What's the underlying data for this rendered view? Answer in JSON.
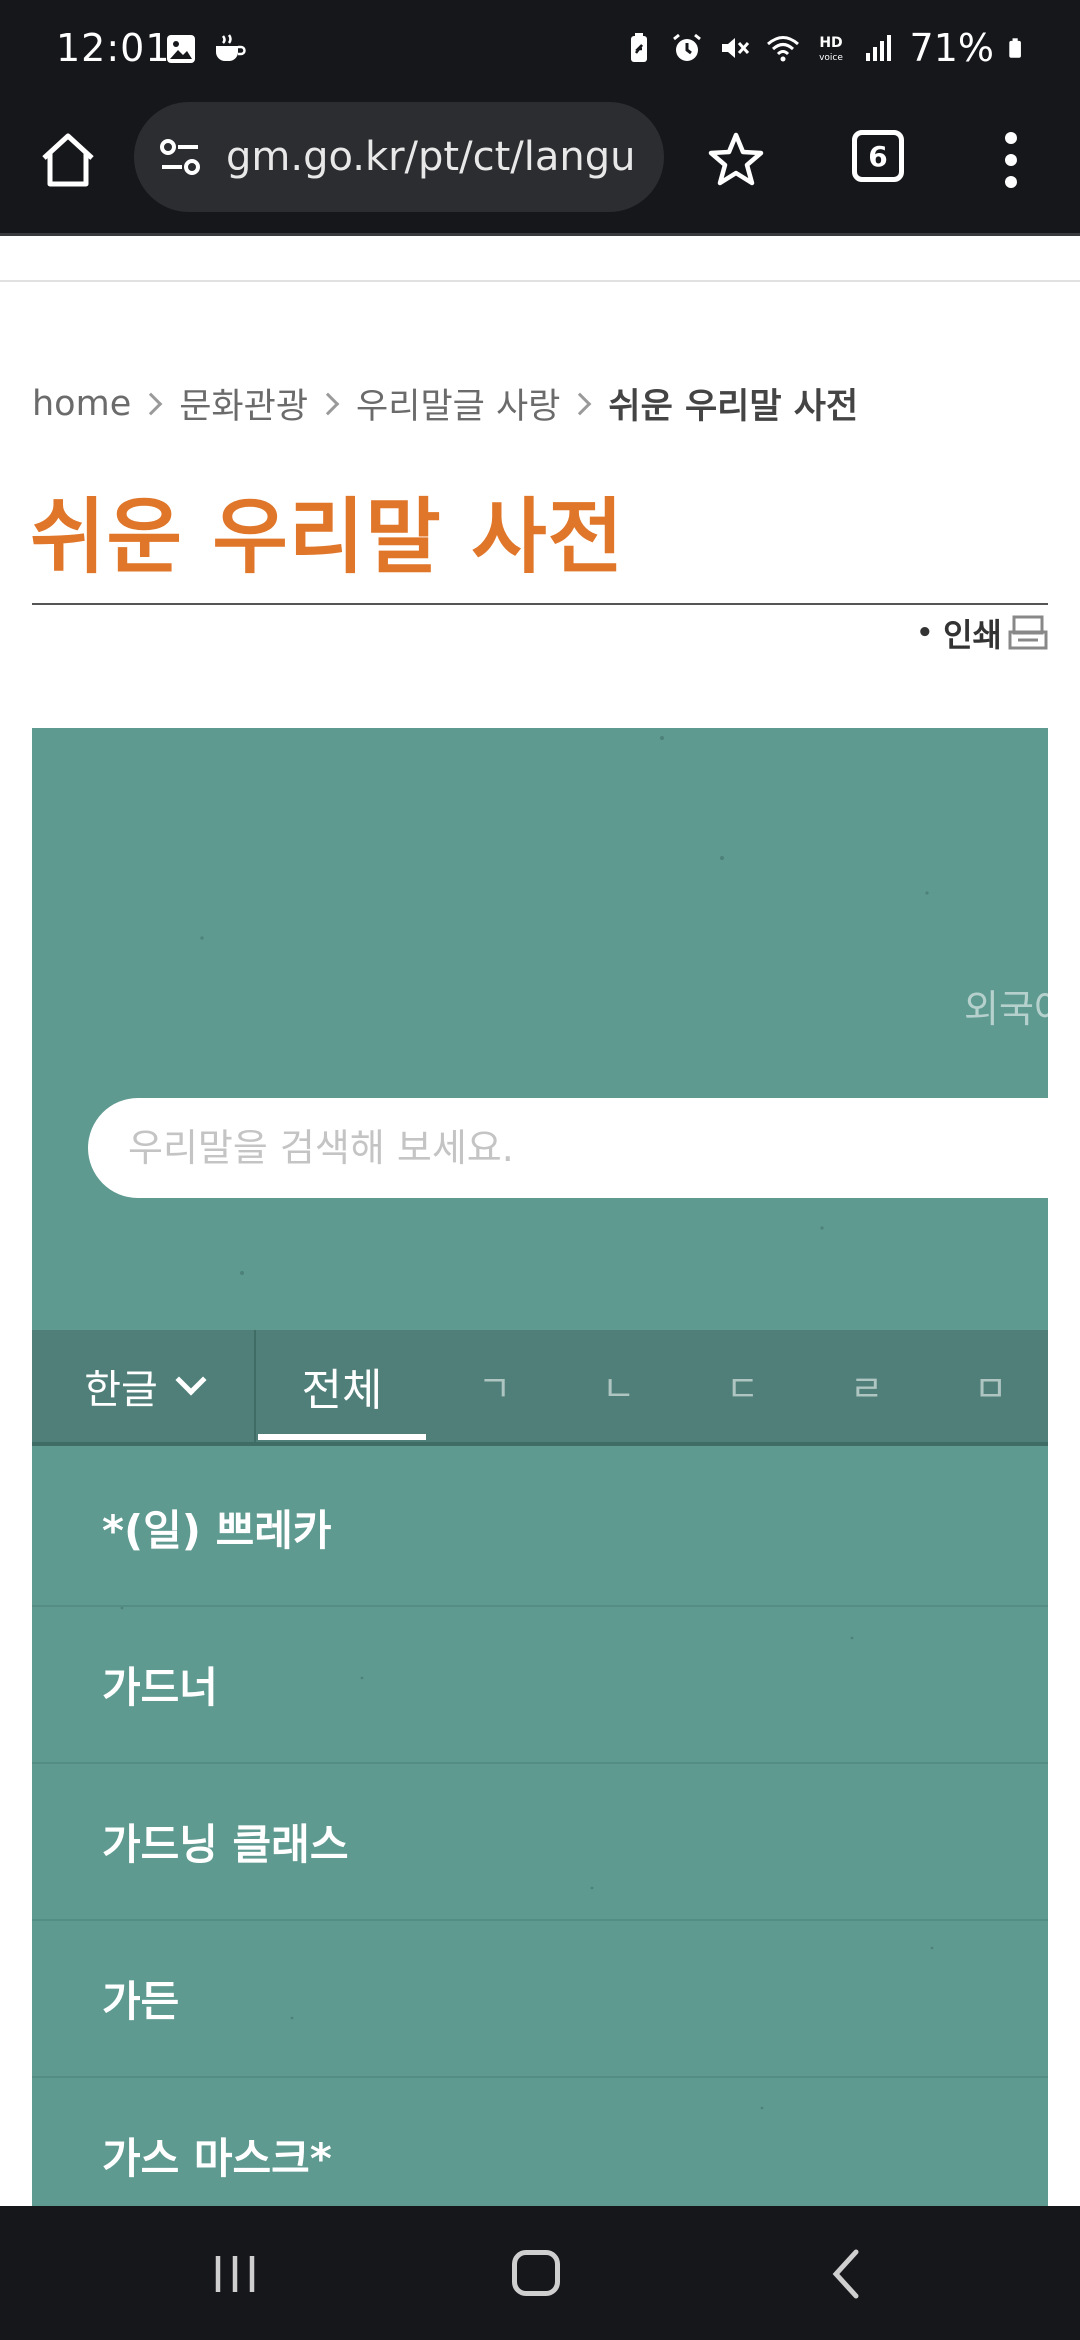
{
  "status_bar": {
    "time": "12:01",
    "battery": "71%",
    "left_icons": [
      "gallery-icon",
      "coffee-icon"
    ],
    "right_icons": [
      "battery-saver-icon",
      "alarm-icon",
      "mute-icon",
      "wifi-icon",
      "hd-voice-icon",
      "signal-icon",
      "battery-icon"
    ]
  },
  "browser": {
    "url": "gm.go.kr/pt/ct/langu",
    "tab_count": "6"
  },
  "breadcrumb": {
    "items": [
      "home",
      "문화관광",
      "우리말글 사랑"
    ],
    "current": "쉬운 우리말 사전"
  },
  "page": {
    "title": "쉬운 우리말 사전",
    "print_label": "인쇄"
  },
  "panel": {
    "foreign_label": "외국어",
    "search_placeholder": "우리말을 검색해 보세요.",
    "language_select": "한글",
    "index_tabs": {
      "all": "전체",
      "consonants": [
        "ㄱ",
        "ㄴ",
        "ㄷ",
        "ㄹ",
        "ㅁ"
      ]
    },
    "words": [
      "*(일) 쁘레카",
      "가드너",
      "가드닝 클래스",
      "가든",
      "가스 마스크*"
    ]
  },
  "colors": {
    "accent": "#e0762a",
    "panel": "#5e9a90",
    "index_bar": "#4f7f78",
    "system_bar": "#16171b"
  }
}
